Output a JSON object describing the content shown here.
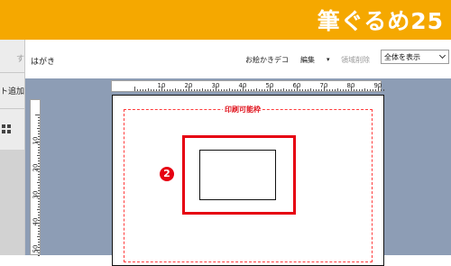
{
  "app": {
    "logo": "筆ぐるめ25",
    "brand_color": "#f5a800"
  },
  "left_panel": {
    "partial_text_1": "す",
    "partial_text_2": "ト追加",
    "grid_icon": "grid-icon"
  },
  "toolbar": {
    "doc_title": "はがき",
    "decorate_label": "お絵かきデコ",
    "edit_label": "編集",
    "edit_arrow": "▾",
    "delete_region_label": "領域削除",
    "view_select_value": "全体を表示"
  },
  "canvas": {
    "printable_area_label": "印刷可能枠",
    "badge_number": "2",
    "accent_color": "#e60012"
  },
  "rulers": {
    "horizontal_labels": [
      "10",
      "20",
      "30",
      "40",
      "50",
      "60",
      "70",
      "80",
      "90"
    ],
    "vertical_labels": [
      "10",
      "20",
      "30",
      "40",
      "50"
    ]
  }
}
